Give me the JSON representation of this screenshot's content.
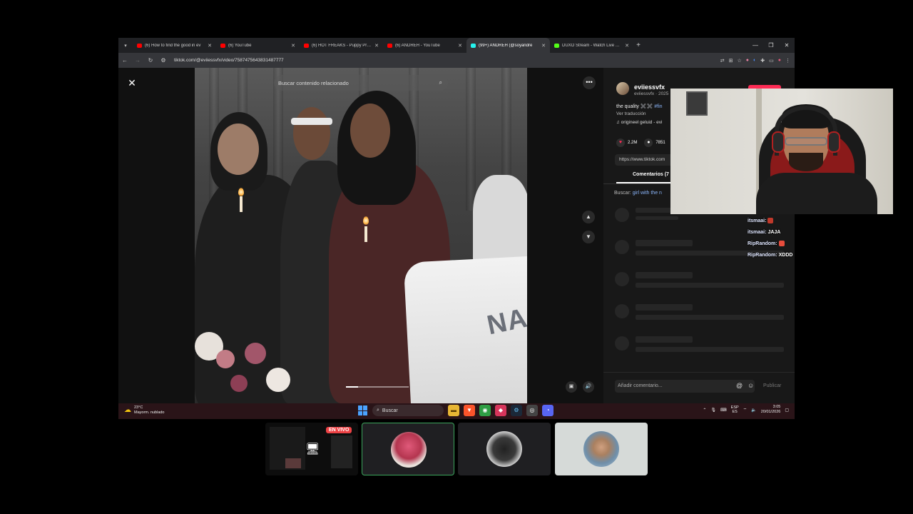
{
  "browser": {
    "tabs": [
      {
        "title": "(6) How to find the good in ev",
        "color": "#ff0000",
        "active": false
      },
      {
        "title": "(6) YouTube",
        "color": "#ff0000",
        "active": false
      },
      {
        "title": "(6) HOT FREAKS - Puppy Prince",
        "color": "#ff0000",
        "active": false
      },
      {
        "title": "(6) ANDREH - YouTube",
        "color": "#ff0000",
        "active": false
      },
      {
        "title": "(99+) ANDREH (@soyandre",
        "color": "#25f4ee",
        "active": true
      },
      {
        "title": "DUXO Stream - Watch Live on K",
        "color": "#53fc18",
        "active": false
      }
    ],
    "url": "tiktok.com/@eviiessvfx/video/7587475643831487777"
  },
  "video": {
    "search_placeholder": "Buscar contenido relacionado",
    "podium_text": "NA",
    "progress": 0.19
  },
  "panel": {
    "author_name": "eviiessvfx",
    "author_sub": "eviiessvfx · 2025",
    "caption_text": "the quality ✖️✖️",
    "caption_tag": "#fin",
    "translate": "Ver traducción",
    "sound": "♫ origineel geluid - evi",
    "likes": "2.2M",
    "comments_count": "7851",
    "link": "https://www.tiktok.com",
    "comments_tab": "Comentarios (7",
    "related_prefix": "Buscar:",
    "related_query": "girl with the n",
    "comment_placeholder": "Añadir comentario...",
    "publish": "Publicar"
  },
  "taskbar": {
    "temp": "23°C",
    "weather": "Mayorm. nublado",
    "search": "Buscar",
    "lang1": "ESP",
    "lang2": "ES",
    "time": "3:05",
    "date": "20/01/2026"
  },
  "chat": [
    {
      "user": "itsmaai:",
      "msg": "",
      "emote_color": "#c0392b"
    },
    {
      "user": "itsmaai:",
      "msg": "JAJA",
      "emote_color": ""
    },
    {
      "user": "RipRandom:",
      "msg": "",
      "emote_color": "#e74c3c"
    },
    {
      "user": "RipRandom:",
      "msg": "XDDD",
      "emote_color": ""
    }
  ],
  "discord": {
    "live_label": "EN VIVO"
  },
  "colors": {
    "tiktok_accent": "#fe2c55",
    "taskbar": "#2a1418",
    "discord_speaking": "#3ba55c"
  }
}
